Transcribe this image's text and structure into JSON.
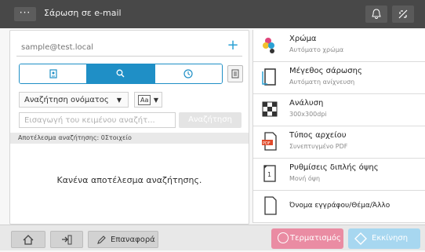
{
  "titlebar": {
    "menu_label": "···",
    "title": "Σάρωση σε e-mail"
  },
  "email": {
    "placeholder": "sample@test.local",
    "add_label": "+"
  },
  "search": {
    "mode_dropdown": "Αναζήτηση ονόματος",
    "aa_label": "Aa",
    "input_placeholder": "Εισαγωγή του κειμένου αναζήτ...",
    "button_label": "Αναζήτηση",
    "result_header": "Αποτέλεσμα αναζήτησης: 0Στοιχείο",
    "no_result": "Κανένα αποτέλεσμα αναζήτησης."
  },
  "options": [
    {
      "title": "Χρώμα",
      "value": "Αυτόματο χρώμα",
      "icon": "color-icon"
    },
    {
      "title": "Μέγεθος σάρωσης",
      "value": "Αυτόματη ανίχνευση",
      "icon": "scan-size-icon"
    },
    {
      "title": "Ανάλυση",
      "value": "300x300dpi",
      "icon": "resolution-icon"
    },
    {
      "title": "Τύπος αρχείου",
      "value": "Συνεπτυγμένο PDF",
      "icon": "file-type-icon"
    },
    {
      "title": "Ρυθμίσεις διπλής όψης",
      "value": "Μονή όψη",
      "icon": "duplex-icon"
    },
    {
      "title": "Όνομα εγγράφου/Θέμα/Άλλο",
      "icon": "document-name-icon"
    }
  ],
  "bottom": {
    "reset_label": "Επαναφορά",
    "stop_label": "Τερματισμός",
    "start_label": "Εκκίνηση"
  },
  "colors": {
    "accent": "#1f8fc6",
    "stop": "#ea8ca3",
    "start": "#a7d7f0",
    "titlebar": "#484848"
  }
}
